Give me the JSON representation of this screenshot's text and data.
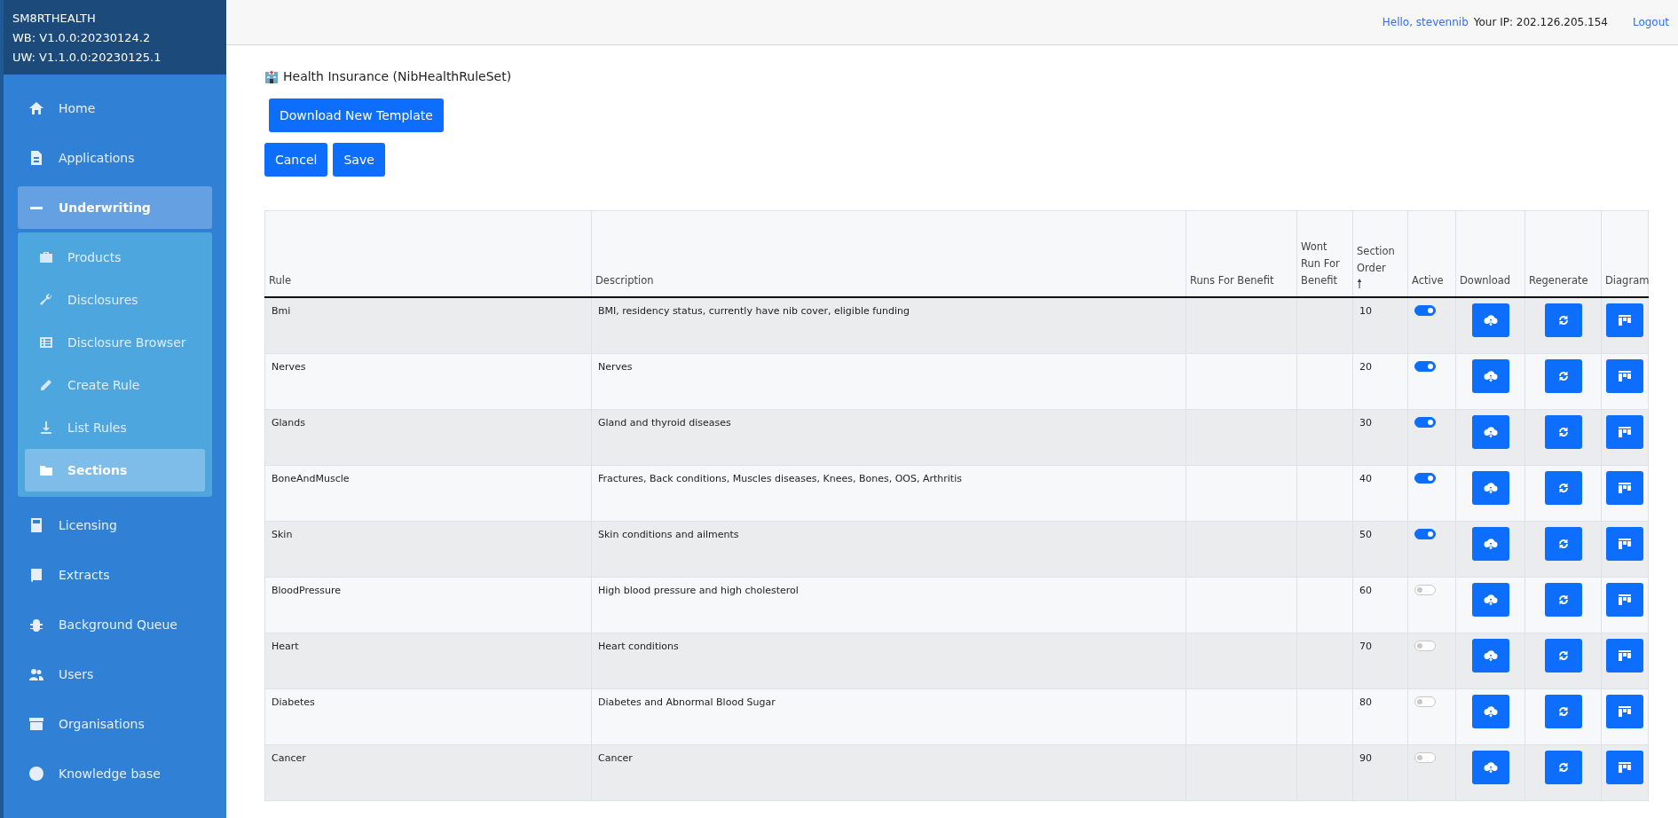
{
  "brand": {
    "name": "SM8RTHEALTH",
    "versions": [
      "WB: V1.0.0:20230124.2",
      "UW: V1.1.0.0:20230125.1"
    ]
  },
  "nav": [
    {
      "label": "Home",
      "selected": false
    },
    {
      "label": "Applications",
      "selected": false
    },
    {
      "label": "Underwriting",
      "selected": true,
      "expanded": true,
      "children": [
        {
          "label": "Products",
          "selected": false
        },
        {
          "label": "Disclosures",
          "selected": false
        },
        {
          "label": "Disclosure Browser",
          "selected": false
        },
        {
          "label": "Create Rule",
          "selected": false
        },
        {
          "label": "List Rules",
          "selected": false
        },
        {
          "label": "Sections",
          "selected": true
        }
      ]
    },
    {
      "label": "Licensing",
      "selected": false
    },
    {
      "label": "Extracts",
      "selected": false
    },
    {
      "label": "Background Queue",
      "selected": false
    },
    {
      "label": "Users",
      "selected": false
    },
    {
      "label": "Organisations",
      "selected": false
    },
    {
      "label": "Knowledge base",
      "selected": false
    }
  ],
  "header": {
    "greeting": "Hello, stevennib",
    "ip": "Your IP: 202.126.205.154",
    "logout": "Logout"
  },
  "page_title": "Health Insurance (NibHealthRuleSet)",
  "buttons": {
    "download_template": "Download New Template",
    "cancel": "Cancel",
    "save": "Save"
  },
  "table": {
    "columns": [
      "Rule",
      "Description",
      "Runs For Benefit",
      "Wont Run For Benefit",
      "Section Order",
      "Active",
      "Download",
      "Regenerate",
      "Diagram"
    ],
    "sort_indicator": "🠕",
    "rows": [
      {
        "rule": "Bmi",
        "description": "BMI, residency status, currently have nib cover, eligible funding",
        "section_order": "10",
        "active": true
      },
      {
        "rule": "Nerves",
        "description": "Nerves",
        "section_order": "20",
        "active": true
      },
      {
        "rule": "Glands",
        "description": "Gland and thyroid diseases",
        "section_order": "30",
        "active": true
      },
      {
        "rule": "BoneAndMuscle",
        "description": "Fractures, Back conditions, Muscles diseases, Knees, Bones, OOS, Arthritis",
        "section_order": "40",
        "active": true
      },
      {
        "rule": "Skin",
        "description": "Skin conditions and ailments",
        "section_order": "50",
        "active": true
      },
      {
        "rule": "BloodPressure",
        "description": "High blood pressure and high cholesterol",
        "section_order": "60",
        "active": false
      },
      {
        "rule": "Heart",
        "description": "Heart conditions",
        "section_order": "70",
        "active": false
      },
      {
        "rule": "Diabetes",
        "description": "Diabetes and Abnormal Blood Sugar",
        "section_order": "80",
        "active": false
      },
      {
        "rule": "Cancer",
        "description": "Cancer",
        "section_order": "90",
        "active": false
      }
    ]
  }
}
